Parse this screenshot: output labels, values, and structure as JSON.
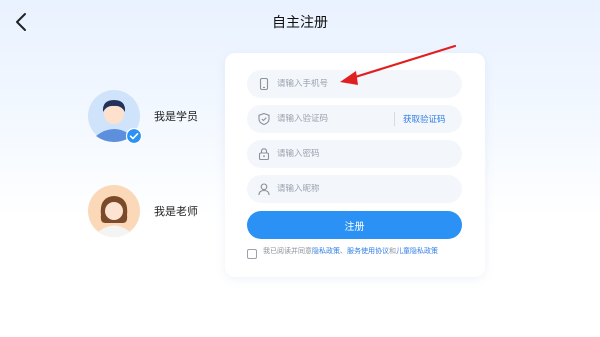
{
  "header": {
    "title": "自主注册",
    "back_icon": "chevron-left-icon"
  },
  "roles": [
    {
      "label": "我是学员",
      "selected": true
    },
    {
      "label": "我是老师",
      "selected": false
    }
  ],
  "form": {
    "phone_placeholder": "请输入手机号",
    "code_placeholder": "请输入验证码",
    "get_code_label": "获取验证码",
    "password_placeholder": "请输入密码",
    "nickname_placeholder": "请输入昵称",
    "submit_label": "注册"
  },
  "agreement": {
    "prefix": "我已阅读并同意",
    "privacy_policy": "隐私政策",
    "sep1": "、",
    "service_agreement": "服务使用协议",
    "and": "和",
    "child_privacy": "儿童隐私政策"
  },
  "colors": {
    "accent": "#2b91f5",
    "link": "#2f7ee6",
    "annotation": "#e02020"
  }
}
